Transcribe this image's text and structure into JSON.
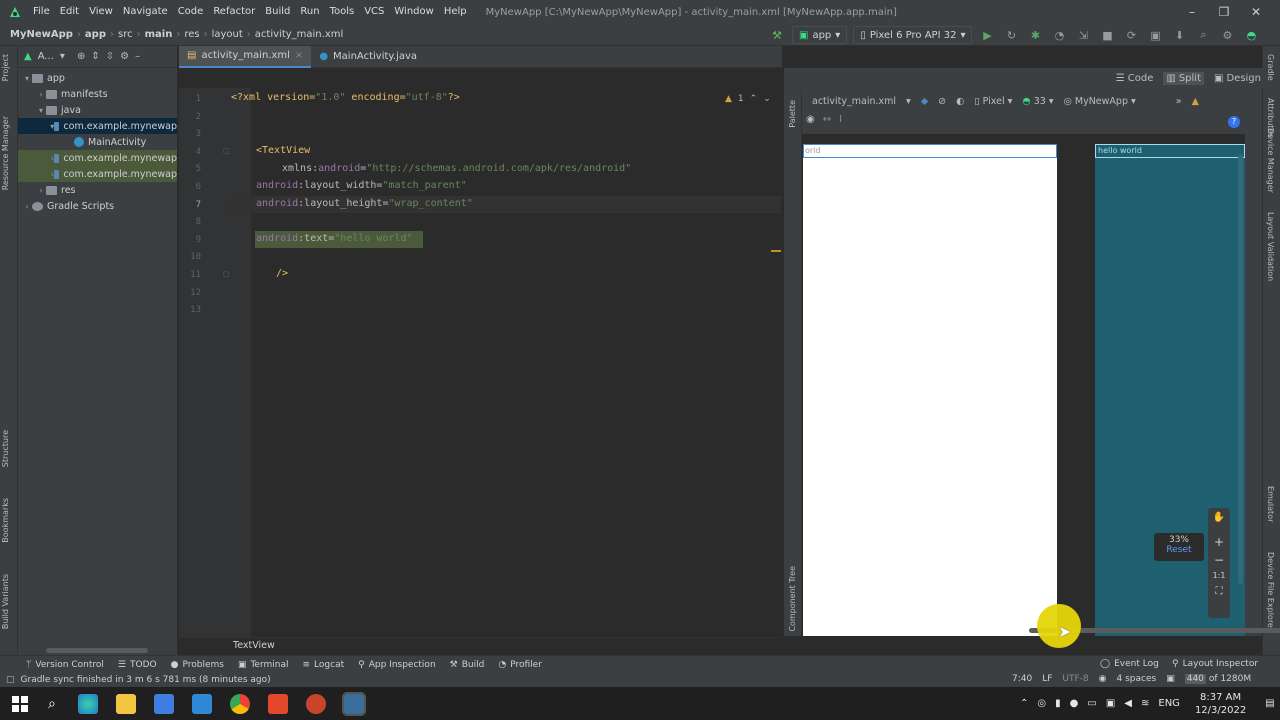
{
  "menubar": {
    "items": [
      "File",
      "Edit",
      "View",
      "Navigate",
      "Code",
      "Refactor",
      "Build",
      "Run",
      "Tools",
      "VCS",
      "Window",
      "Help"
    ],
    "window_title": "MyNewApp [C:\\MyNewApp\\MyNewApp] - activity_main.xml [MyNewApp.app.main]"
  },
  "navbar": {
    "crumbs": [
      "MyNewApp",
      "app",
      "src",
      "main",
      "res",
      "layout",
      "activity_main.xml"
    ],
    "run_config": "app",
    "device": "Pixel 6 Pro API 32"
  },
  "project": {
    "header": "A...",
    "tree": [
      {
        "label": "app",
        "indent": 0,
        "chev": "▾",
        "kind": "fold-grey"
      },
      {
        "label": "manifests",
        "indent": 1,
        "chev": "›",
        "kind": "fold-grey"
      },
      {
        "label": "java",
        "indent": 1,
        "chev": "▾",
        "kind": "fold-grey"
      },
      {
        "label": "com.example.mynewap",
        "indent": 2,
        "chev": "▾",
        "kind": "fold-grey"
      },
      {
        "label": "MainActivity",
        "indent": 3,
        "chev": "",
        "kind": "class"
      },
      {
        "label": "com.example.mynewap",
        "indent": 2,
        "chev": "›",
        "kind": "fold-grey"
      },
      {
        "label": "com.example.mynewap",
        "indent": 2,
        "chev": "›",
        "kind": "fold-grey"
      },
      {
        "label": "res",
        "indent": 1,
        "chev": "›",
        "kind": "fold-grey"
      },
      {
        "label": "Gradle Scripts",
        "indent": 0,
        "chev": "›",
        "kind": "gradle"
      }
    ]
  },
  "left_tabs": [
    "Project",
    "Resource Manager",
    "Structure",
    "Bookmarks",
    "Build Variants"
  ],
  "right_tabs": [
    "Gradle",
    "Attributes",
    "Device Manager",
    "Layout Validation",
    "Emulator",
    "Device File Explorer"
  ],
  "editor": {
    "tabs": [
      "activity_main.xml",
      "MainActivity.java"
    ],
    "line_numbers": [
      "1",
      "2",
      "3",
      "4",
      "5",
      "6",
      "7",
      "8",
      "9",
      "10",
      "11",
      "12",
      "13"
    ],
    "code": {
      "l1_a": "<?xml version=",
      "l1_b": "\"1.0\"",
      "l1_c": " encoding=",
      "l1_d": "\"utf-8\"",
      "l1_e": "?>",
      "l4": "<TextView",
      "l5_a": "xmlns:",
      "l5_b": "android",
      "l5_c": "=",
      "l5_d": "\"http://schemas.android.com/apk/res/android\"",
      "l6_a": "android",
      "l6_b": ":layout_width=",
      "l6_c": "\"match_parent\"",
      "l7_a": "android",
      "l7_b": ":layout_height=",
      "l7_c": "\"wrap_content\"",
      "l9_a": "android",
      "l9_b": ":text=",
      "l9_c": "\"hello world\"",
      "l11": "/>"
    },
    "warnings": "1",
    "breadcrumb": "TextView"
  },
  "design": {
    "modes": [
      "Code",
      "Split",
      "Design"
    ],
    "file": "activity_main.xml",
    "device": "Pixel",
    "api": "33",
    "theme": "MyNewApp",
    "preview_text": "orld",
    "blueprint_text": "hello world",
    "zoom_percent": "33%",
    "zoom_reset": "Reset",
    "palette": "Palette",
    "component_tree": "Component Tree",
    "zoom_one": "1:1"
  },
  "bottom_tools": [
    "Version Control",
    "TODO",
    "Problems",
    "Terminal",
    "Logcat",
    "App Inspection",
    "Build",
    "Profiler"
  ],
  "bottom_right_tools": [
    "Event Log",
    "Layout Inspector"
  ],
  "status": {
    "message": "Gradle sync finished in 3 m 6 s 781 ms (8 minutes ago)",
    "position": "7:40",
    "line_sep": "LF",
    "encoding": "UTF-8",
    "indent": "4 spaces",
    "memory_used": "440",
    "memory_total": "of 1280M"
  },
  "taskbar": {
    "lang": "ENG",
    "time": "8:37 AM",
    "date": "12/3/2022"
  },
  "colors": {
    "accent": "#4a88c7",
    "blueprint": "#1e6070",
    "highlight": "#4b5a3b"
  }
}
